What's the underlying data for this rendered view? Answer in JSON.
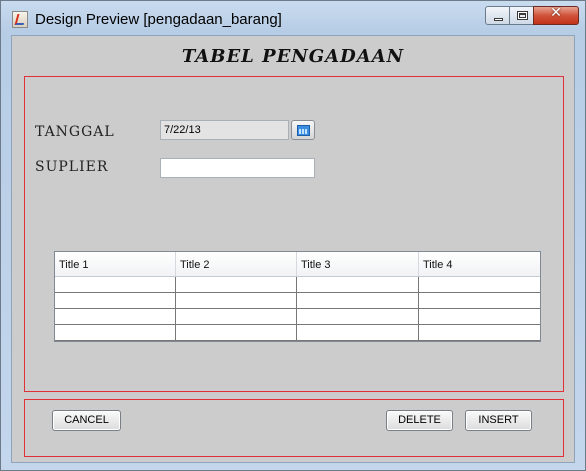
{
  "window": {
    "title": "Design Preview [pengadaan_barang]",
    "icons": [
      "java-app-icon",
      "minimize-icon",
      "maximize-icon",
      "close-icon"
    ],
    "close_glyph": "✕"
  },
  "form": {
    "heading": "TABEL PENGADAAN",
    "tanggal_label": "TANGGAL",
    "tanggal_value": "7/22/13",
    "suplier_label": "SUPLIER",
    "suplier_value": ""
  },
  "table": {
    "columns": [
      "Title 1",
      "Title 2",
      "Title 3",
      "Title 4"
    ],
    "rows": [
      [
        "",
        "",
        "",
        ""
      ],
      [
        "",
        "",
        "",
        ""
      ],
      [
        "",
        "",
        "",
        ""
      ],
      [
        "",
        "",
        "",
        ""
      ]
    ]
  },
  "buttons": {
    "cancel": "CANCEL",
    "delete": "DELETE",
    "insert": "INSERT"
  },
  "colors": {
    "panel_border": "#e0313b",
    "panel_bg": "#cccccc",
    "close_button": "#c1321a"
  }
}
